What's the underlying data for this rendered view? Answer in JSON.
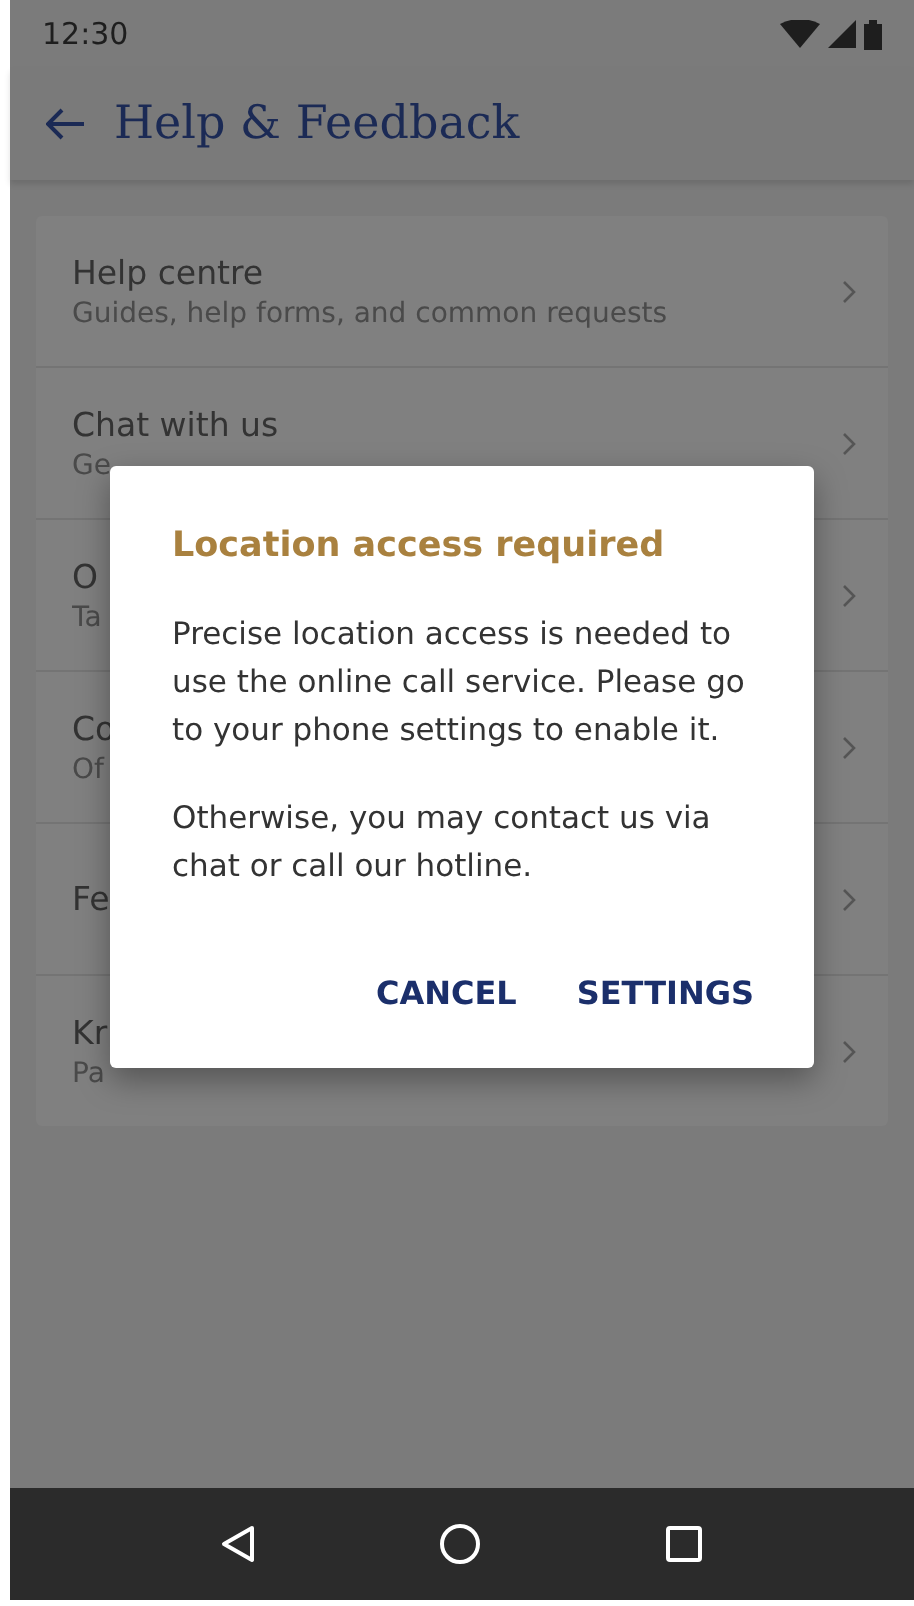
{
  "status_bar": {
    "time": "12:30"
  },
  "app_bar": {
    "title": "Help & Feedback"
  },
  "menu": [
    {
      "title": "Help centre",
      "subtitle": "Guides, help forms, and common requests"
    },
    {
      "title": "Chat with us",
      "subtitle": "Ge"
    },
    {
      "title": "O",
      "subtitle": "Ta"
    },
    {
      "title": "Co",
      "subtitle": "Of"
    },
    {
      "title": "Fe"
    },
    {
      "title": "Kr",
      "subtitle": "Pa"
    }
  ],
  "dialog": {
    "title": "Location access required",
    "paragraphs": [
      "Precise location access is needed to use the online call service. Please go to your phone settings to enable it.",
      "Otherwise, you may contact us via chat or call our hotline."
    ],
    "buttons": [
      "CANCEL",
      "SETTINGS"
    ]
  }
}
